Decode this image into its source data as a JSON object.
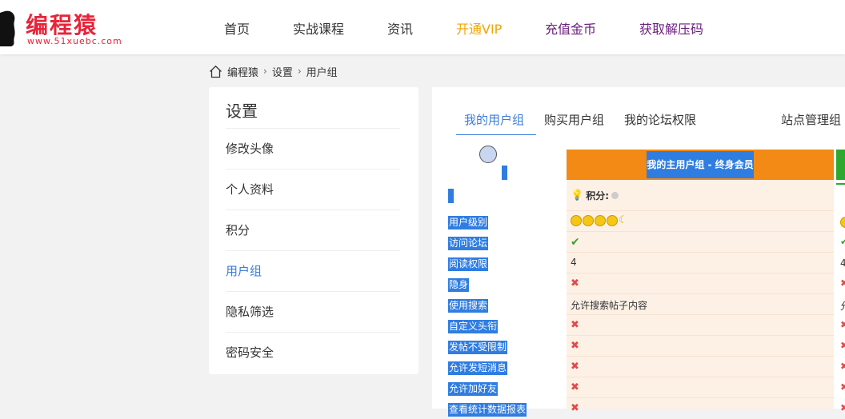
{
  "header": {
    "logo_text": "编程猿",
    "logo_url": "www.51xuebc.com",
    "nav": [
      "首页",
      "实战课程",
      "资讯",
      "开通VIP",
      "充值金币",
      "获取解压码"
    ]
  },
  "breadcrumb": [
    "编程猿",
    "设置",
    "用户组"
  ],
  "sidebar": {
    "title": "设置",
    "items": [
      {
        "label": "修改头像"
      },
      {
        "label": "个人资料"
      },
      {
        "label": "积分"
      },
      {
        "label": "用户组",
        "active": true
      },
      {
        "label": "隐私筛选"
      },
      {
        "label": "密码安全"
      }
    ]
  },
  "tabs": [
    "我的用户组",
    "购买用户组",
    "我的论坛权限",
    "站点管理组"
  ],
  "permissions": {
    "labels": [
      "用户级别",
      "访问论坛",
      "阅读权限",
      "隐身",
      "使用搜索",
      "自定义头衔",
      "发帖不受限制",
      "允许发短消息",
      "允许加好友",
      "查看统计数据报表"
    ],
    "group": {
      "title": "我的主用户组 - 终身会员",
      "points_label": "积分:",
      "level_icons": [
        "smiley-face-icon",
        "smiley-face-icon",
        "smiley-face-icon",
        "smiley-face-icon",
        "moon-icon"
      ],
      "values": [
        "level",
        "ok",
        "4",
        "no",
        "允许搜索帖子内容",
        "no",
        "no",
        "no",
        "no",
        "no"
      ]
    },
    "group2_values": [
      "level",
      "ok",
      "4",
      "no",
      "允",
      "no",
      "no",
      "no",
      "no",
      "no"
    ]
  },
  "colors": {
    "accent": "#3b7dd8",
    "vip": "#f0a500",
    "brand": "#e8243a",
    "group_header": "#f28a15",
    "group_body": "#fdf1e6",
    "selection": "#2f7de1"
  }
}
